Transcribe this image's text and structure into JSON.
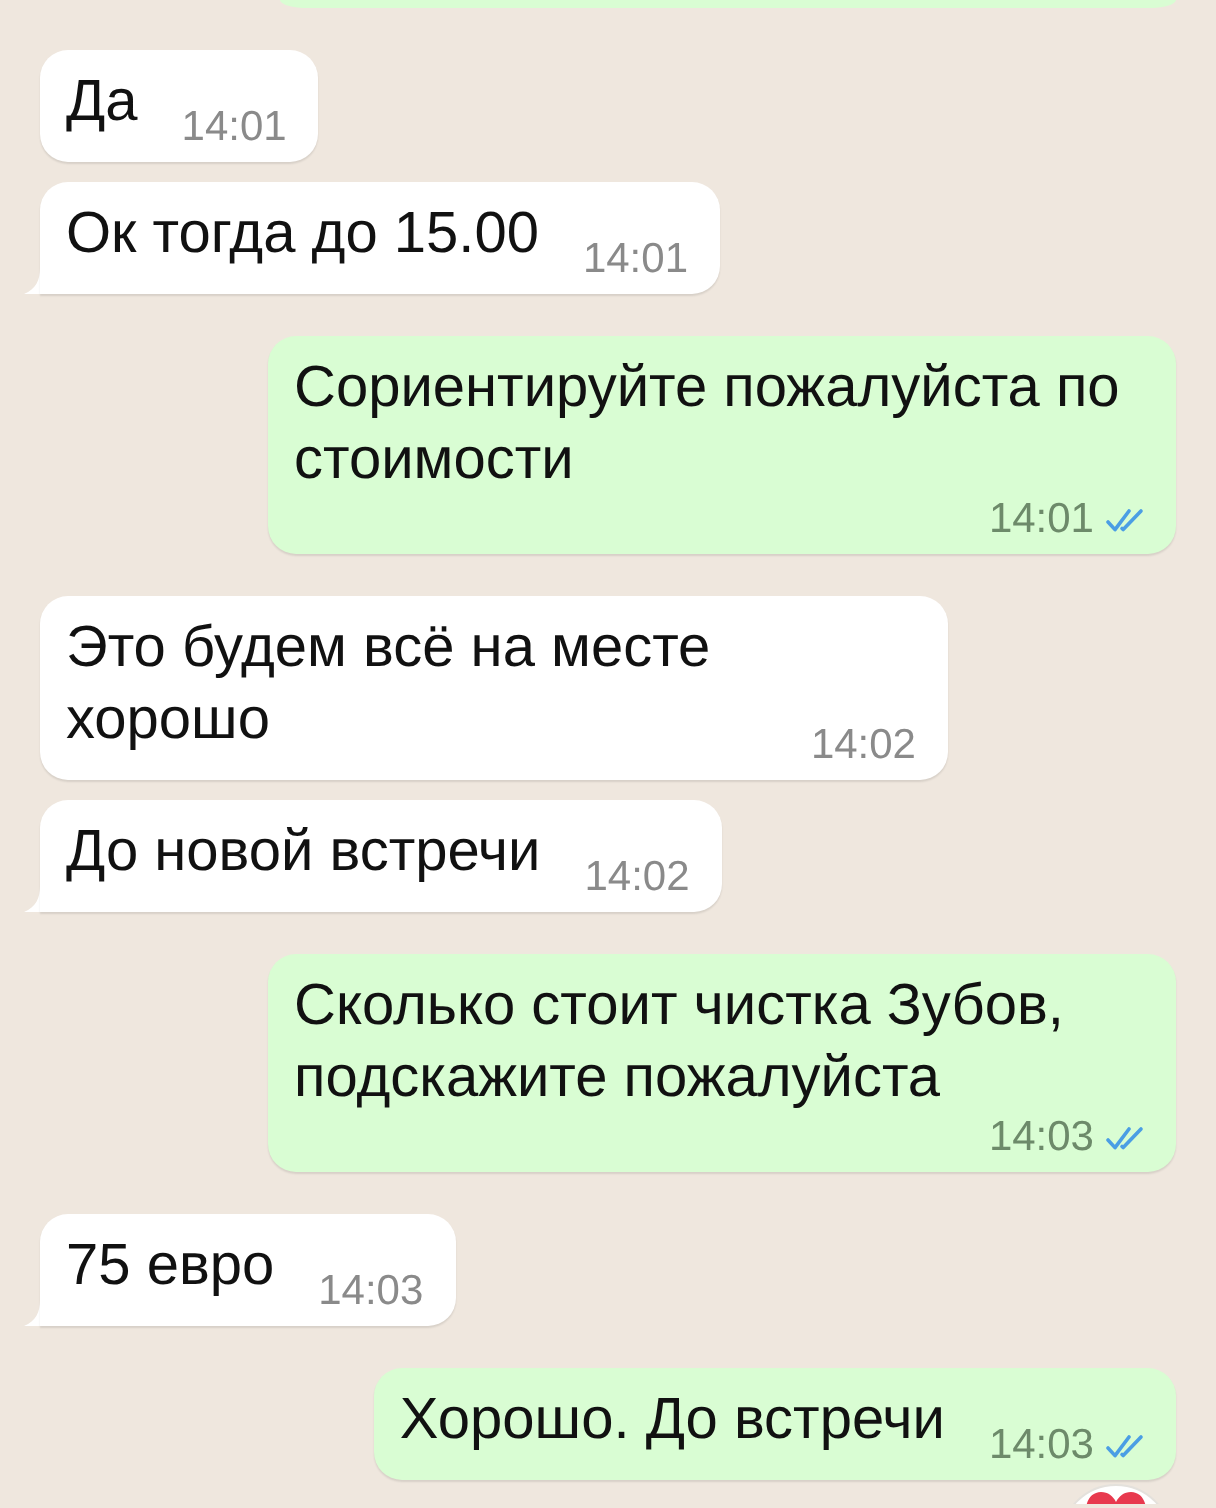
{
  "cut_off_message": {
    "kind": "outgoing"
  },
  "messages": [
    {
      "kind": "incoming",
      "text": "Да",
      "time": "14:01",
      "tail": false
    },
    {
      "kind": "incoming",
      "text": "Ок тогда до 15.00",
      "time": "14:01",
      "tail": true
    },
    {
      "kind": "outgoing",
      "text": "Сориентируйте пожалуйста по стоимости",
      "time": "14:01",
      "tail": false,
      "read": true
    },
    {
      "kind": "incoming",
      "text": "Это будем всё на месте хорошо",
      "time": "14:02",
      "tail": false
    },
    {
      "kind": "incoming",
      "text": "До новой встречи",
      "time": "14:02",
      "tail": true
    },
    {
      "kind": "outgoing",
      "text": "Сколько стоит чистка Зубов, подскажите пожалуйста",
      "time": "14:03",
      "tail": false,
      "read": true
    },
    {
      "kind": "incoming",
      "text": "75 евро",
      "time": "14:03",
      "tail": true
    },
    {
      "kind": "outgoing",
      "text": "Хорошо. До встречи",
      "time": "14:03",
      "tail": false,
      "read": true,
      "reaction": {
        "kind": "heart"
      }
    }
  ]
}
